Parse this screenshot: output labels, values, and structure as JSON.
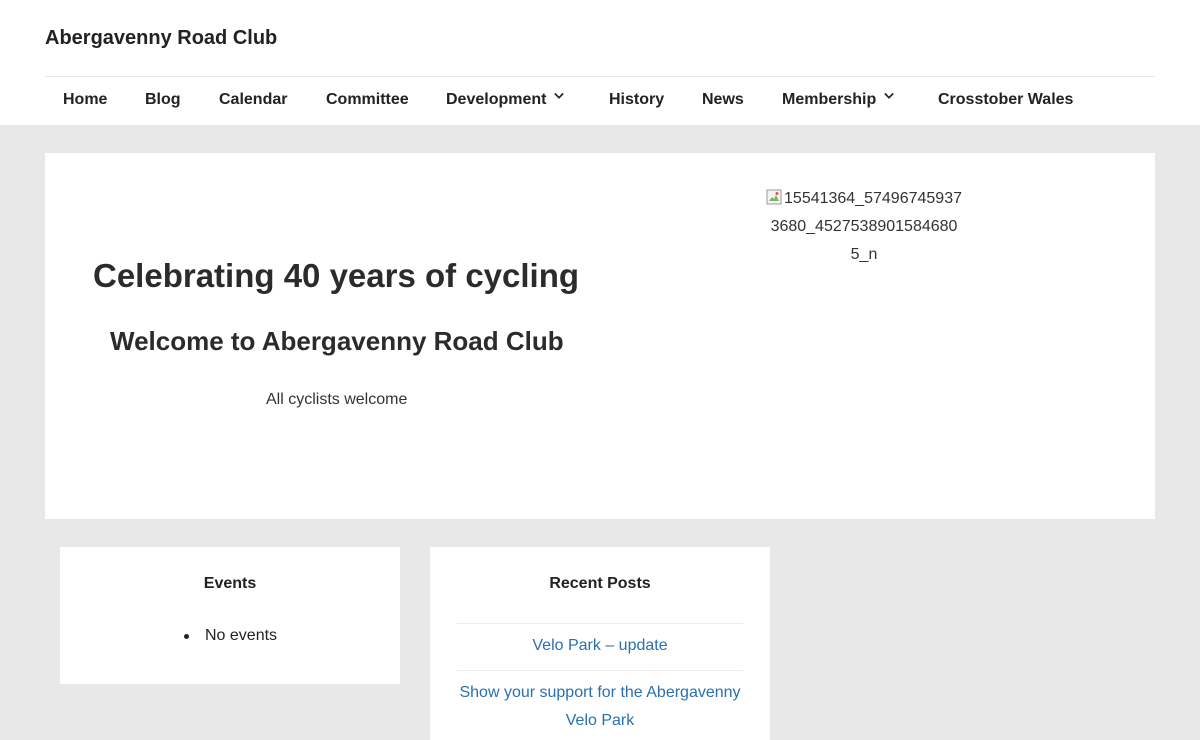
{
  "site": {
    "title": "Abergavenny Road Club"
  },
  "nav": {
    "items": [
      {
        "label": "Home"
      },
      {
        "label": "Blog"
      },
      {
        "label": "Calendar"
      },
      {
        "label": "Committee"
      },
      {
        "label": "Development",
        "has_dropdown": true
      },
      {
        "label": "History"
      },
      {
        "label": "News"
      },
      {
        "label": "Membership",
        "has_dropdown": true
      },
      {
        "label": "Crosstober Wales"
      }
    ]
  },
  "hero": {
    "heading": "Celebrating 40 years of cycling",
    "subheading": "Welcome to Abergavenny Road Club",
    "tagline": "All cyclists welcome",
    "image_alt": "15541364_574967459373680_4527538901584680 5_n"
  },
  "widgets": {
    "events": {
      "title": "Events",
      "items": [
        "No events"
      ]
    },
    "recent_posts": {
      "title": "Recent Posts",
      "items": [
        {
          "label": "Velo Park – update"
        },
        {
          "label": "Show your support for the Abergavenny Velo Park"
        }
      ]
    }
  },
  "colors": {
    "link": "#2a6fb0",
    "page_bg": "#e8e8e8",
    "panel_bg": "#ffffff"
  }
}
